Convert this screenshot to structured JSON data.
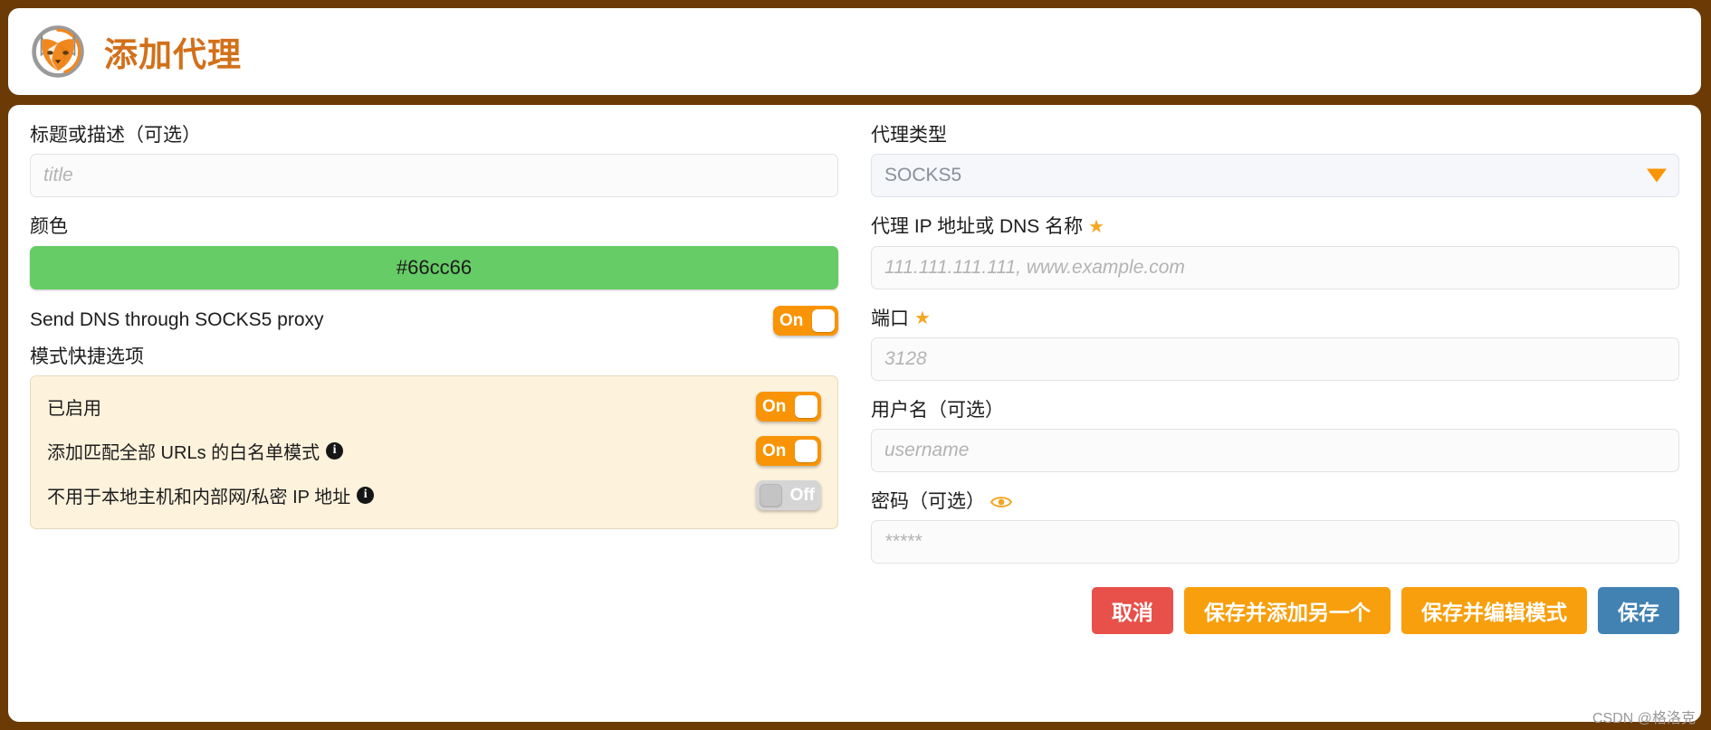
{
  "header": {
    "title": "添加代理",
    "logo_icon": "foxyproxy-fox-logo"
  },
  "left": {
    "title_label": "标题或描述（可选）",
    "title_placeholder": "title",
    "color_label": "颜色",
    "color_value": "#66cc66",
    "dns": {
      "label": "Send DNS through SOCKS5 proxy",
      "state": "On"
    },
    "mode_section_label": "模式快捷选项",
    "mode_options": [
      {
        "label": "已启用",
        "has_info": false,
        "state": "On"
      },
      {
        "label": "添加匹配全部 URLs 的白名单模式",
        "has_info": true,
        "state": "On"
      },
      {
        "label": "不用于本地主机和内部网/私密 IP 地址",
        "has_info": true,
        "state": "Off"
      }
    ]
  },
  "right": {
    "proxy_type_label": "代理类型",
    "proxy_type_value": "SOCKS5",
    "proxy_type_options": [
      "SOCKS5"
    ],
    "host_label": "代理 IP 地址或 DNS 名称",
    "host_required_marker": "★",
    "host_placeholder": "111.111.111.111, www.example.com",
    "port_label": "端口",
    "port_required_marker": "★",
    "port_placeholder": "3128",
    "username_label": "用户名（可选）",
    "username_placeholder": "username",
    "password_label": "密码（可选）",
    "password_eye_icon": "eye-icon",
    "password_placeholder": "*****"
  },
  "buttons": {
    "cancel": "取消",
    "save_and_add_another": "保存并添加另一个",
    "save_and_edit_patterns": "保存并编辑模式",
    "save": "保存"
  },
  "watermark": "CSDN @格洛克",
  "colors": {
    "frame": "#6b3a05",
    "accent_orange": "#f89406",
    "title_orange": "#d2701a",
    "swatch_green": "#66cc66",
    "cancel_red": "#e8514a",
    "save_blue": "#4182b3",
    "mode_panel_bg": "#fdf2dc"
  }
}
